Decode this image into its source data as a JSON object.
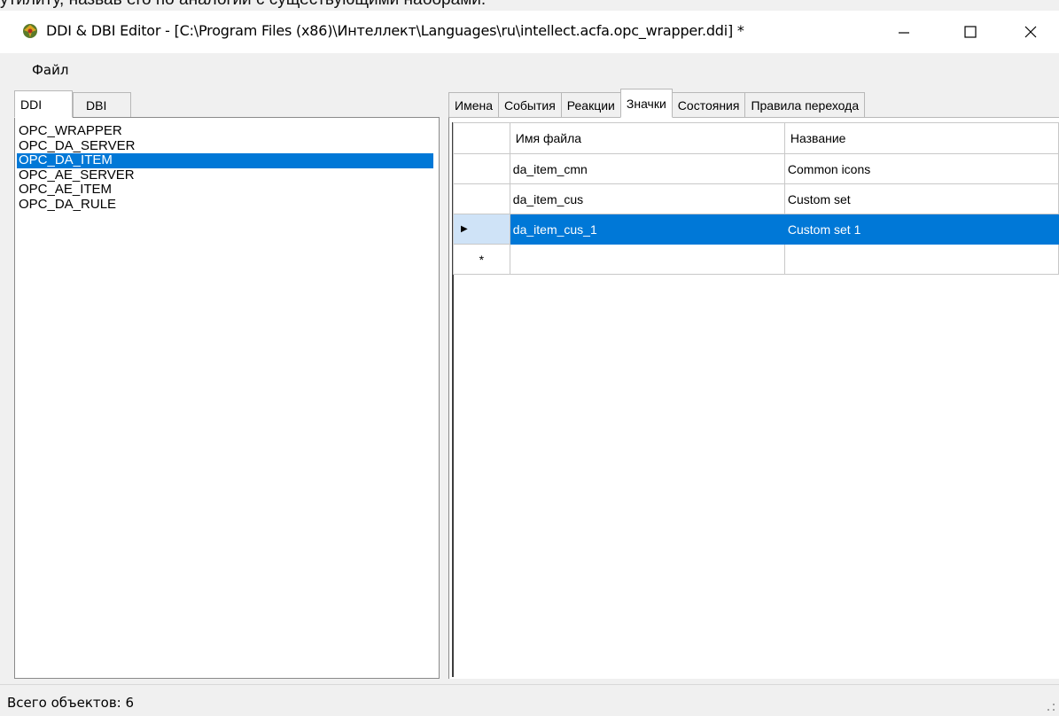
{
  "doc_fragment": "утилиту, назвав его по аналогии с существующими наборами.",
  "window": {
    "title": "DDI & DBI Editor - [C:\\Program Files (x86)\\Интеллект\\Languages\\ru\\intellect.acfa.opc_wrapper.ddi] *"
  },
  "menu": {
    "file": "Файл"
  },
  "left_tabs": [
    "DDI",
    "DBI"
  ],
  "objects": [
    "OPC_WRAPPER",
    "OPC_DA_SERVER",
    "OPC_DA_ITEM",
    "OPC_AE_SERVER",
    "OPC_AE_ITEM",
    "OPC_DA_RULE"
  ],
  "selected_object": "OPC_DA_ITEM",
  "right_tabs": [
    "Имена",
    "События",
    "Реакции",
    "Значки",
    "Состояния",
    "Правила перехода"
  ],
  "active_right_tab": "Значки",
  "grid": {
    "columns": [
      "Имя файла",
      "Название"
    ],
    "rows": [
      [
        "da_item_cmn",
        "Common icons"
      ],
      [
        "da_item_cus",
        "Custom set"
      ],
      [
        "da_item_cus_1",
        "Custom set 1"
      ]
    ],
    "current_row_marker": "▶",
    "new_row_marker": "*"
  },
  "status": "Всего объектов: 6",
  "colors": {
    "selection": "#0078d7",
    "row_header_selected": "#cfe3f7"
  }
}
